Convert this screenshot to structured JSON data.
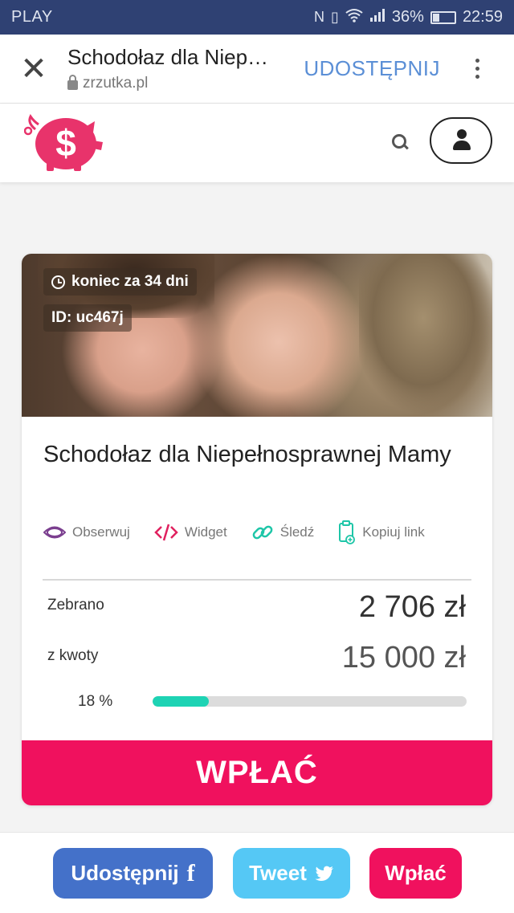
{
  "status_bar": {
    "carrier": "PLAY",
    "battery_percent": "36%",
    "time": "22:59",
    "battery_level": 0.36,
    "icons": [
      "nfc-icon",
      "vibrate-icon",
      "wifi-icon",
      "signal-icon",
      "battery-icon"
    ]
  },
  "tab_bar": {
    "close_icon": "✕",
    "title": "Schodołaz dla Niepełnosprawnej Mamy",
    "url": "zrzutka.pl",
    "share_label": "UDOSTĘPNIJ"
  },
  "campaign": {
    "end_badge": "koniec za 34 dni",
    "id_badge": "ID: uc467j",
    "title": "Schodołaz dla Niepełnosprawnej Mamy",
    "actions": [
      {
        "label": "Obserwuj",
        "icon": "eye-icon",
        "color": "#7b3f8f"
      },
      {
        "label": "Widget",
        "icon": "code-icon",
        "color": "#e0215f"
      },
      {
        "label": "Śledź",
        "icon": "link-icon",
        "color": "#1ec6a8"
      },
      {
        "label": "Kopiuj link",
        "icon": "clipboard-icon",
        "color": "#1ec6a8"
      }
    ],
    "collected_label": "Zebrano",
    "collected_value": "2 706 zł",
    "goal_label": "z kwoty",
    "goal_value": "15 000 zł",
    "percent_label": "18 %",
    "progress": 0.18,
    "pay_label": "WPŁAĆ"
  },
  "share_bar": {
    "facebook_label": "Udostępnij",
    "tweet_label": "Tweet",
    "pay_label": "Wpłać"
  },
  "colors": {
    "brand_pink": "#f0115e",
    "progress_green": "#1ed3b4",
    "facebook_blue": "#4471c9",
    "twitter_blue": "#55c8f5"
  }
}
